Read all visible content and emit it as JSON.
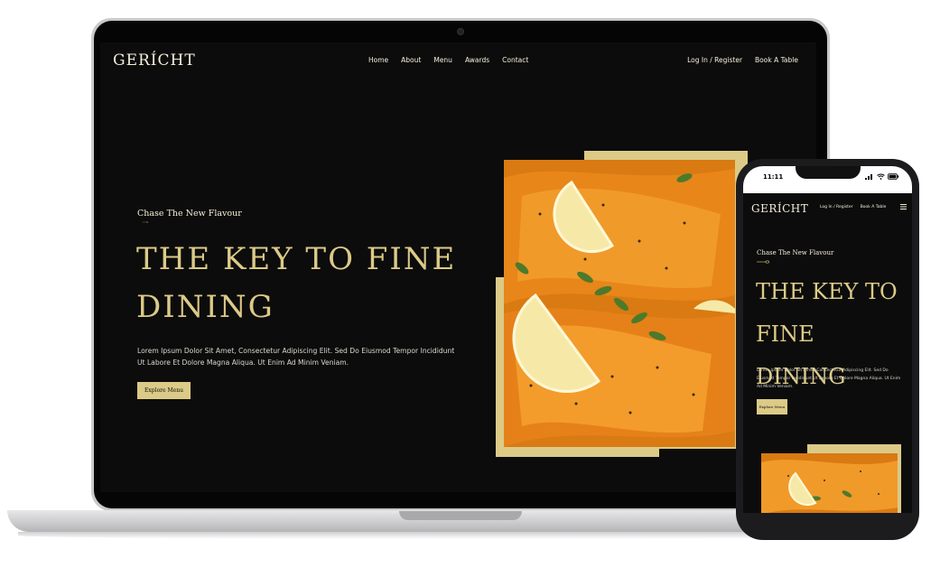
{
  "site": {
    "logo": "GERÍCHT",
    "nav": [
      "Home",
      "About",
      "Menu",
      "Awards",
      "Contact"
    ],
    "nav_right": [
      "Log In / Register",
      "Book A Table"
    ],
    "subtitle": "Chase The New Flavour",
    "title_line1": "THE KEY TO FINE",
    "title_line2": "DINING",
    "description": "Lorem Ipsum Dolor Sit Amet, Consectetur Adipiscing Elit. Sed Do Eiusmod Tempor Incididunt Ut Labore Et Dolore Magna Aliqua. Ut Enim Ad Minim Veniam.",
    "cta": "Explore Menu"
  },
  "phone": {
    "time": "11:11",
    "logo": "GERÍCHT",
    "nav_right": [
      "Log In / Register",
      "Book A Table"
    ],
    "subtitle": "Chase The New Flavour",
    "title_line1": "THE KEY TO",
    "title_line2": "FINE DINING",
    "description": "Lorem Ipsum Dolor Sit Amet, Consectetur Adipiscing Elit. Sed Do Eiusmod Tempor Incididunt Ut Labore Et Dolore Magna Aliqua. Ut Enim Ad Minim Veniam.",
    "cta": "Explore Menu"
  },
  "colors": {
    "gold": "#dcca87",
    "background": "#0c0c0c",
    "text_light": "#f5efdb"
  },
  "icons": {
    "spoon": "spoon-icon",
    "menu": "hamburger-menu-icon",
    "signal": "signal-icon",
    "wifi": "wifi-icon",
    "battery": "battery-icon"
  }
}
